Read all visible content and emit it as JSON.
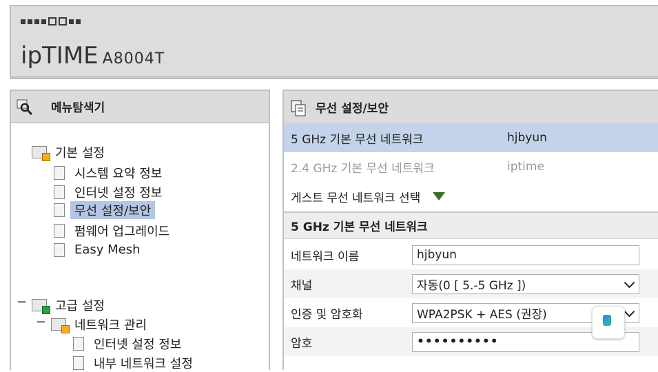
{
  "brand": {
    "name": "ipTIME",
    "model": "A8004T"
  },
  "menu": {
    "title": "메뉴탐색기",
    "basic": {
      "label": "기본 설정",
      "items": [
        "시스템 요약 정보",
        "인터넷 설정 정보",
        "무선 설정/보안",
        "펌웨어 업그레이드",
        "Easy Mesh"
      ]
    },
    "advanced": {
      "label": "고급 설정",
      "network": {
        "label": "네트워크 관리",
        "items": [
          "인터넷 설정 정보",
          "내부 네트워크 설정"
        ]
      }
    }
  },
  "panel": {
    "title": "무선 설정/보안",
    "networks": [
      {
        "label": "5 GHz 기본 무선 네트워크",
        "ssid": "hjbyun"
      },
      {
        "label": "2.4 GHz 기본 무선 네트워크",
        "ssid": "iptime"
      }
    ],
    "guest_label": "게스트 무선 네트워크 선택",
    "section_title": "5 GHz 기본 무선 네트워크",
    "fields": {
      "name_label": "네트워크 이름",
      "name_value": "hjbyun",
      "channel_label": "채널",
      "channel_value": "자동(0 [ 5.-5 GHz ])",
      "auth_label": "인증 및 암호화",
      "auth_value": "WPA2PSK + AES (권장)",
      "pw_label": "암호",
      "pw_value": "••••••••••"
    }
  },
  "colors": {
    "selected_row": "#c4d3ea",
    "tree_selected": "#b4c6e4",
    "guest_arrow": "#3f6a2a"
  }
}
